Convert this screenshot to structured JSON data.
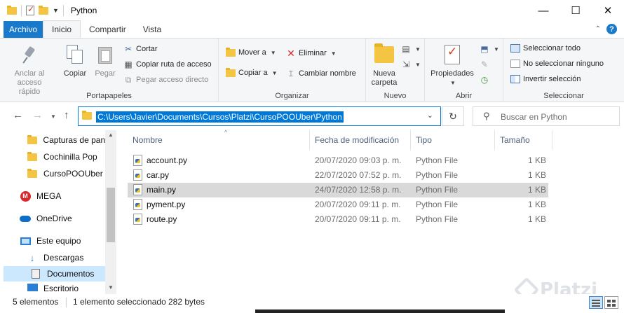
{
  "window": {
    "title": "Python"
  },
  "ribbon_tabs": {
    "file": "Archivo",
    "home": "Inicio",
    "share": "Compartir",
    "view": "Vista"
  },
  "ribbon": {
    "portapapeles": {
      "label": "Portapapeles",
      "pin_line1": "Anclar al",
      "pin_line2": "acceso rápido",
      "copy": "Copiar",
      "paste": "Pegar",
      "cut": "Cortar",
      "copy_path": "Copiar ruta de acceso",
      "paste_shortcut": "Pegar acceso directo"
    },
    "organizar": {
      "label": "Organizar",
      "move_to": "Mover a",
      "copy_to": "Copiar a",
      "delete": "Eliminar",
      "rename": "Cambiar nombre"
    },
    "nuevo": {
      "label": "Nuevo",
      "new_folder_line1": "Nueva",
      "new_folder_line2": "carpeta"
    },
    "abrir": {
      "label": "Abrir",
      "properties": "Propiedades"
    },
    "seleccionar": {
      "label": "Seleccionar",
      "select_all": "Seleccionar todo",
      "select_none": "No seleccionar ninguno",
      "invert": "Invertir selección"
    }
  },
  "address": {
    "path": "C:\\Users\\Javier\\Documents\\Cursos\\Platzi\\CursoPOOUber\\Python"
  },
  "search": {
    "placeholder": "Buscar en Python"
  },
  "nav_pane": {
    "items": [
      {
        "label": "Capturas de pantalla",
        "icon": "folder-icon"
      },
      {
        "label": "Cochinilla Pop",
        "icon": "folder-icon"
      },
      {
        "label": "CursoPOOUber",
        "icon": "folder-icon"
      },
      {
        "label": "MEGA",
        "icon": "mega-icon"
      },
      {
        "label": "OneDrive",
        "icon": "onedrive-icon"
      },
      {
        "label": "Este equipo",
        "icon": "computer-icon"
      },
      {
        "label": "Descargas",
        "icon": "download-icon"
      },
      {
        "label": "Documentos",
        "icon": "documents-icon"
      },
      {
        "label": "Escritorio",
        "icon": "desktop-icon"
      }
    ]
  },
  "file_list": {
    "columns": {
      "name": "Nombre",
      "date": "Fecha de modificación",
      "type": "Tipo",
      "size": "Tamaño"
    },
    "rows": [
      {
        "name": "account.py",
        "date": "20/07/2020 09:03 p. m.",
        "type": "Python File",
        "size": "1 KB"
      },
      {
        "name": "car.py",
        "date": "22/07/2020 07:52 p. m.",
        "type": "Python File",
        "size": "1 KB"
      },
      {
        "name": "main.py",
        "date": "24/07/2020 12:58 p. m.",
        "type": "Python File",
        "size": "1 KB",
        "selected": true
      },
      {
        "name": "pyment.py",
        "date": "20/07/2020 09:11 p. m.",
        "type": "Python File",
        "size": "1 KB"
      },
      {
        "name": "route.py",
        "date": "20/07/2020 09:11 p. m.",
        "type": "Python File",
        "size": "1 KB"
      }
    ]
  },
  "status": {
    "count": "5 elementos",
    "selection": "1 elemento seleccionado",
    "size": "282 bytes"
  },
  "watermark": {
    "text": "Platzi"
  },
  "colors": {
    "accent": "#0078d7",
    "file_tab": "#1979ca",
    "selection": "#d9d9d9",
    "nav_selection": "#cce8ff"
  }
}
